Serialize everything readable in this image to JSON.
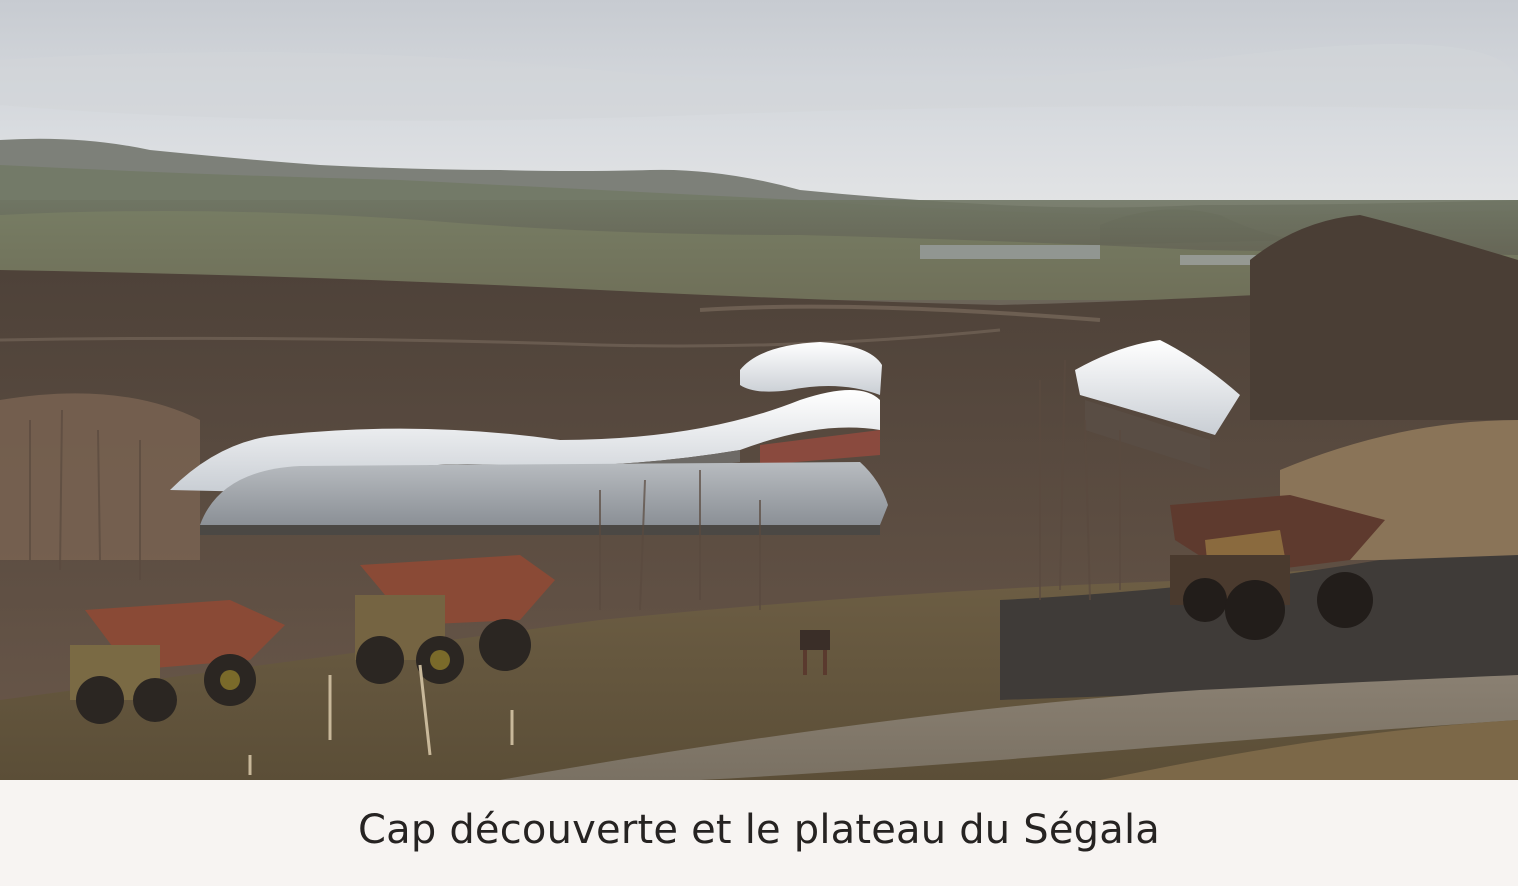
{
  "caption": {
    "text": "Cap découverte et le plateau du Ségala"
  },
  "photo": {
    "subject": "landscape-photo"
  }
}
